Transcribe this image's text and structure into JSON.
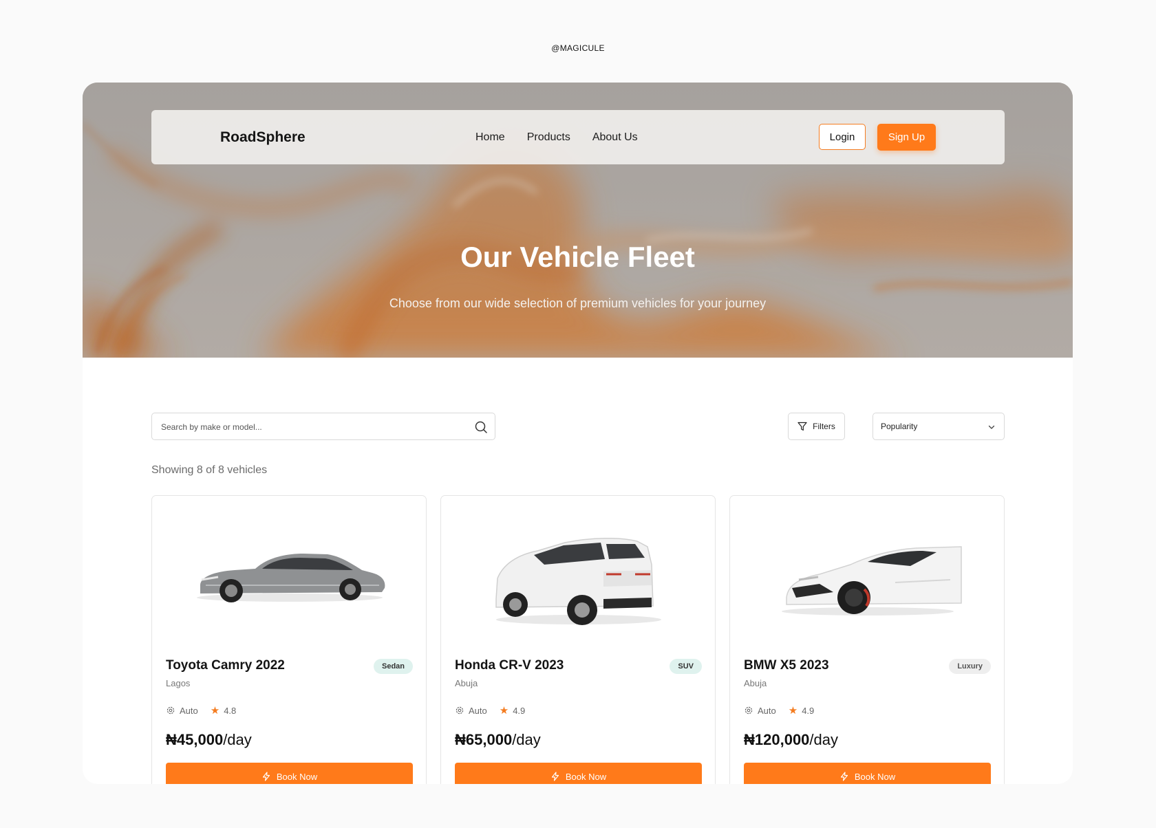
{
  "watermark": "@MAGICULE",
  "nav": {
    "brand": "RoadSphere",
    "links": [
      "Home",
      "Products",
      "About Us"
    ],
    "login": "Login",
    "signup": "Sign Up"
  },
  "hero": {
    "title": "Our Vehicle Fleet",
    "subtitle": "Choose from our wide selection of premium vehicles for your journey"
  },
  "toolbar": {
    "search_placeholder": "Search by make or model...",
    "filters_label": "Filters",
    "sort_value": "Popularity"
  },
  "results": {
    "summary": "Showing 8 of 8 vehicles"
  },
  "cards": [
    {
      "name": "Toyota Camry 2022",
      "badge": "Sedan",
      "location": "Lagos",
      "transmission": "Auto",
      "rating": "4.8",
      "price": "₦45,000",
      "unit": "/day",
      "cta": "Book Now"
    },
    {
      "name": "Honda CR-V 2023",
      "badge": "SUV",
      "location": "Abuja",
      "transmission": "Auto",
      "rating": "4.9",
      "price": "₦65,000",
      "unit": "/day",
      "cta": "Book Now"
    },
    {
      "name": "BMW X5 2023",
      "badge": "Luxury",
      "location": "Abuja",
      "transmission": "Auto",
      "rating": "4.9",
      "price": "₦120,000",
      "unit": "/day",
      "cta": "Book Now"
    }
  ],
  "colors": {
    "accent": "#ff7a1a",
    "badge_sedan": "#dff2ee",
    "badge_suv": "#dff2ee",
    "badge_luxury": "#eeeeee"
  },
  "icons": {
    "search": "search-icon",
    "filters": "filter-icon",
    "sort": "chevron-down-icon",
    "transmission": "gear-icon",
    "rating": "star-icon",
    "book": "lightning-icon"
  }
}
